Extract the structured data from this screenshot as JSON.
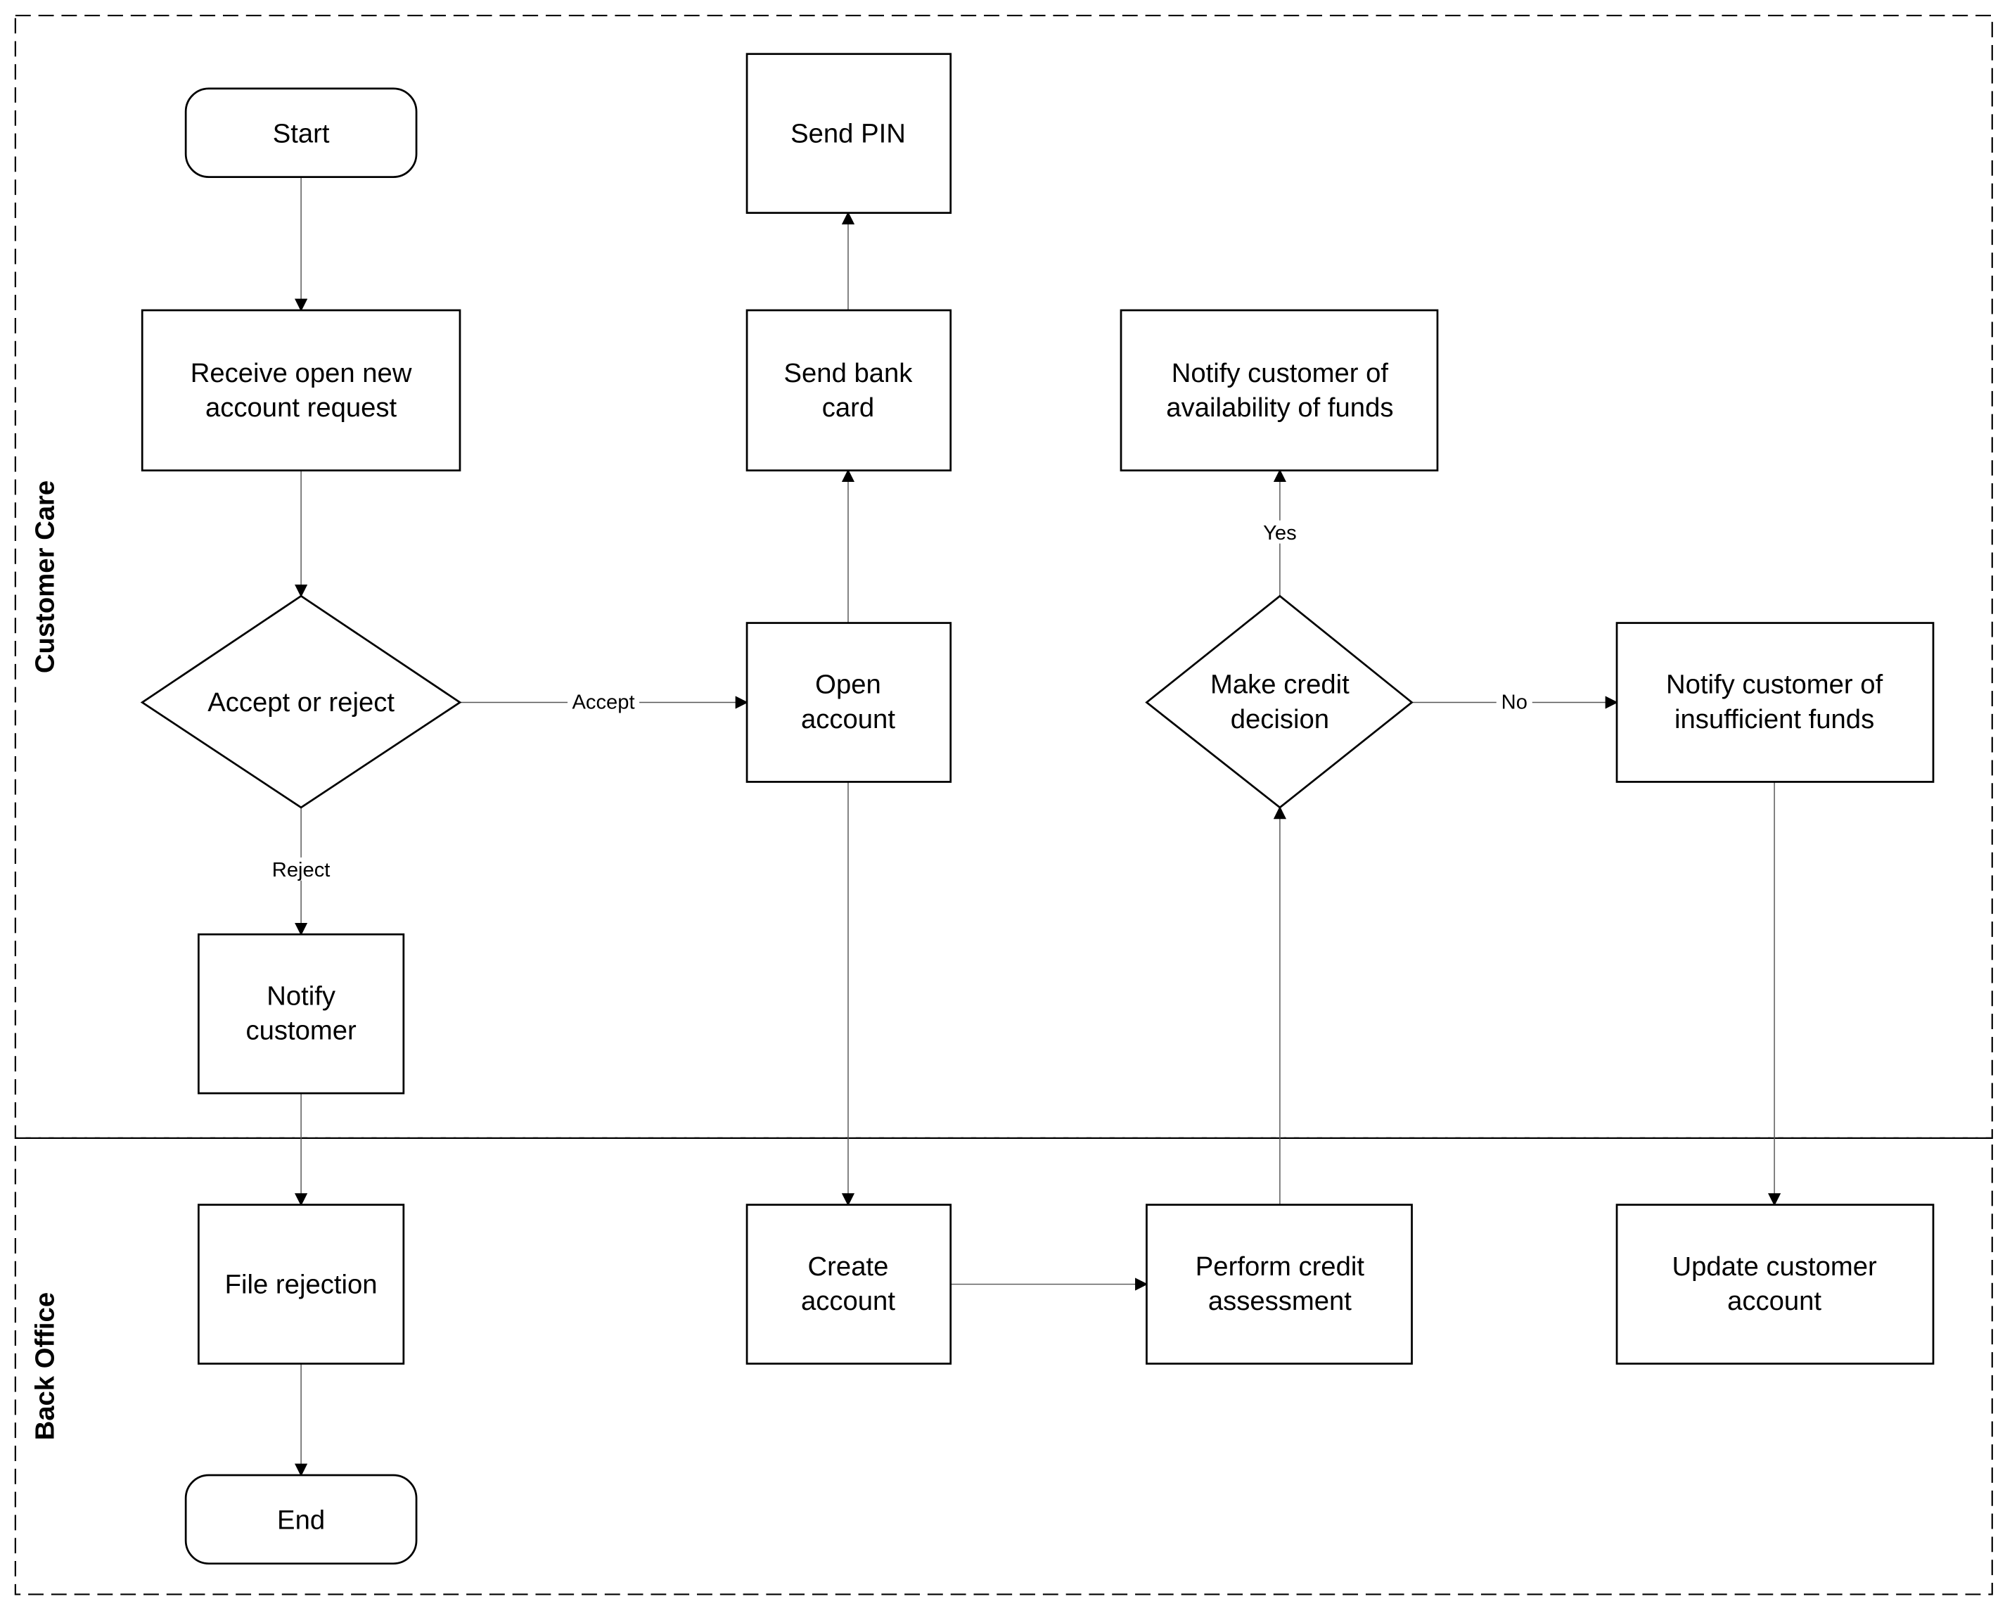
{
  "lanes": {
    "customer_care": "Customer Care",
    "back_office": "Back Office"
  },
  "nodes": {
    "start": "Start",
    "receive": [
      "Receive open new",
      "account request"
    ],
    "decision_accept": "Accept or reject",
    "notify_customer": [
      "Notify",
      "customer"
    ],
    "file_rejection": "File rejection",
    "end": "End",
    "send_pin": "Send PIN",
    "send_card": [
      "Send bank",
      "card"
    ],
    "open_account": [
      "Open",
      "account"
    ],
    "create_account": [
      "Create",
      "account"
    ],
    "perform_credit": [
      "Perform credit",
      "assessment"
    ],
    "credit_decision": [
      "Make credit",
      "decision"
    ],
    "notify_funds": [
      "Notify customer of",
      "availability of funds"
    ],
    "notify_insufficient": [
      "Notify customer of",
      "insufficient funds"
    ],
    "update_account": [
      "Update customer",
      "account"
    ]
  },
  "edge_labels": {
    "accept": "Accept",
    "reject": "Reject",
    "yes": "Yes",
    "no": "No"
  }
}
